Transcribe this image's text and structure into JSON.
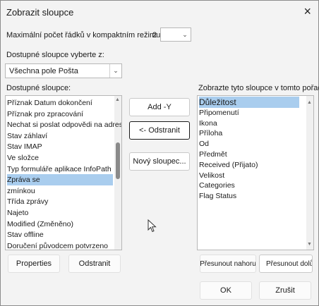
{
  "dialog": {
    "title": "Zobrazit sloupce",
    "close_icon": "×"
  },
  "compact": {
    "label": "Maximální počet řádků v kompaktním režimu:",
    "value": "2"
  },
  "source": {
    "label": "Dostupné sloupce vyberte z:",
    "selected": "Všechna pole Pošta"
  },
  "available": {
    "label": "Dostupné sloupce:",
    "items": [
      "Příznak Datum dokončení",
      "Příznak pro zpracování",
      "Nechat si poslat odpovědi na adresu",
      "Stav záhlaví",
      "Stav IMAP",
      "Ve složce",
      "Typ formuláře aplikace InfoPath",
      "Zpráva se",
      "zmínkou",
      "Třída zprávy",
      "Najeto",
      "Modified (Změněno)",
      "Stav offline",
      "Doručení původcem potvrzeno"
    ],
    "selected_index": 7
  },
  "shown": {
    "label": "Zobrazte tyto sloupce v tomto pořadí:",
    "items": [
      "Důležitost",
      "Připomenutí",
      "Ikona",
      "Příloha",
      "Od",
      "Předmět",
      "Received (Přijato)",
      "Velikost",
      "Categories",
      "Flag Status"
    ],
    "selected_index": 0
  },
  "buttons": {
    "add": "Add -Y",
    "remove": "<- Odstranit",
    "new_column": "Nový sloupec...",
    "properties": "Properties",
    "delete": "Odstranit",
    "move_up": "Přesunout nahoru",
    "move_down": "Přesunout dolů",
    "ok": "OK",
    "cancel": "Zrušit"
  }
}
